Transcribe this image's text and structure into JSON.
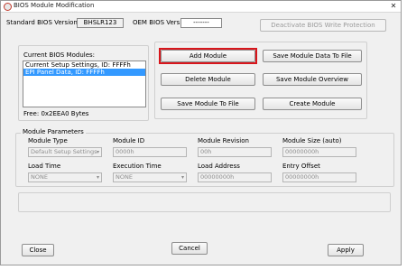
{
  "window": {
    "title": "BIOS Module Modification",
    "close_glyph": "✕"
  },
  "header": {
    "standard_label": "Standard BIOS Version:",
    "standard_value": "BHSLR123",
    "oem_label": "OEM BIOS Version:",
    "oem_value": "-------",
    "deactivate_label": "Deactivate BIOS Write Protection"
  },
  "modules": {
    "list_label": "Current BIOS Modules:",
    "items": [
      {
        "label": "Current Setup Settings, ID: FFFFh"
      },
      {
        "label": "EPI Panel Data, ID: FFFFh"
      }
    ],
    "free_label": "Free: 0x2EEA0 Bytes"
  },
  "actions": {
    "add": "Add  Module",
    "save_data": "Save Module Data To File",
    "delete": "Delete Module",
    "overview": "Save Module Overview",
    "save_file": "Save Module To File",
    "create": "Create Module"
  },
  "params": {
    "group_label": "Module Parameters",
    "type_label": "Module Type",
    "type_value": "Default Setup Settings",
    "id_label": "Module ID",
    "id_value": "0000h",
    "revision_label": "Module Revision",
    "revision_value": "00h",
    "size_label": "Module Size (auto)",
    "size_value": "00000000h",
    "load_time_label": "Load Time",
    "load_time_value": "NONE",
    "exec_time_label": "Execution Time",
    "exec_time_value": "NONE",
    "load_addr_label": "Load Address",
    "load_addr_value": "00000000h",
    "entry_label": "Entry Offset",
    "entry_value": "00000000h"
  },
  "footer": {
    "close": "Close",
    "cancel": "Cancel",
    "apply": "Apply"
  },
  "colors": {
    "highlight": "#d8161c",
    "selection": "#3399ff"
  }
}
